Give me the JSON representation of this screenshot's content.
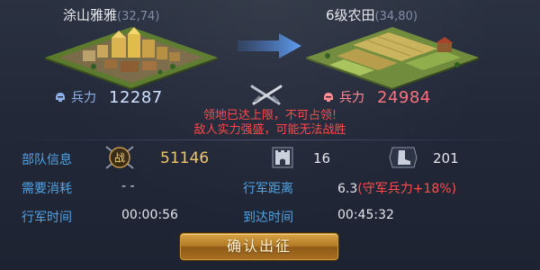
{
  "source": {
    "name": "涂山雅雅",
    "coords": "(32,74)",
    "troop_label": "兵力",
    "troop_value": "12287"
  },
  "target": {
    "name": "6级农田",
    "coords": "(34,80)",
    "troop_label": "兵力",
    "troop_value": "24984"
  },
  "warnings": [
    "领地已达上限，不可占领!",
    "敌人实力强盛，可能无法战胜"
  ],
  "info": {
    "team_label": "部队信息",
    "power_badge": "战",
    "power_value": "51146",
    "wall_value": "16",
    "speed_value": "201",
    "consume_label": "需要消耗",
    "consume_value": "- -",
    "distance_label": "行军距离",
    "distance_value": "6.3",
    "distance_bonus": "(守军兵力+18%)",
    "march_time_label": "行军时间",
    "march_time_value": "00:00:56",
    "arrive_label": "到达时间",
    "arrive_value": "00:45:32"
  },
  "confirm_button": "确认出征",
  "icons": {
    "troop_source": "soldier-helmet-icon",
    "troop_target": "soldier-helmet-icon",
    "vs": "crossed-swords-icon",
    "power": "battle-badge-icon",
    "wall": "castle-wall-icon",
    "speed": "boot-icon",
    "direction": "arrow-right-icon"
  },
  "colors": {
    "label_blue": "#4fa3e6",
    "warning_red": "#ff4545",
    "power_gold": "#f1c56a",
    "button_gold": "#b27a25"
  }
}
